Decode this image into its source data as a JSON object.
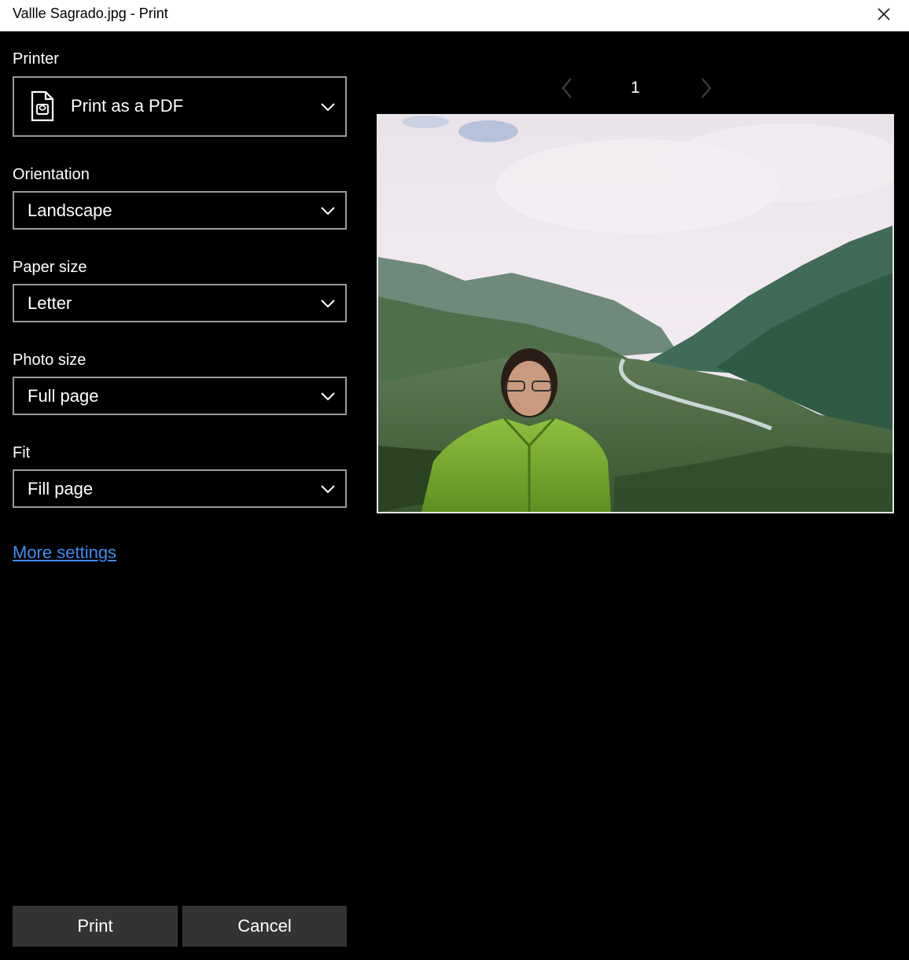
{
  "window": {
    "title": "Vallle Sagrado.jpg - Print"
  },
  "settings": {
    "printer": {
      "label": "Printer",
      "value": "Print as a PDF",
      "icon": "pdf-document-icon"
    },
    "orientation": {
      "label": "Orientation",
      "value": "Landscape"
    },
    "paper_size": {
      "label": "Paper size",
      "value": "Letter"
    },
    "photo_size": {
      "label": "Photo size",
      "value": "Full page"
    },
    "fit": {
      "label": "Fit",
      "value": "Fill page"
    },
    "more_settings": "More settings"
  },
  "preview": {
    "page_number": "1"
  },
  "actions": {
    "print": "Print",
    "cancel": "Cancel"
  },
  "colors": {
    "link": "#3f8df0",
    "button_bg": "#333333",
    "dropdown_border": "#9a9a9a"
  }
}
